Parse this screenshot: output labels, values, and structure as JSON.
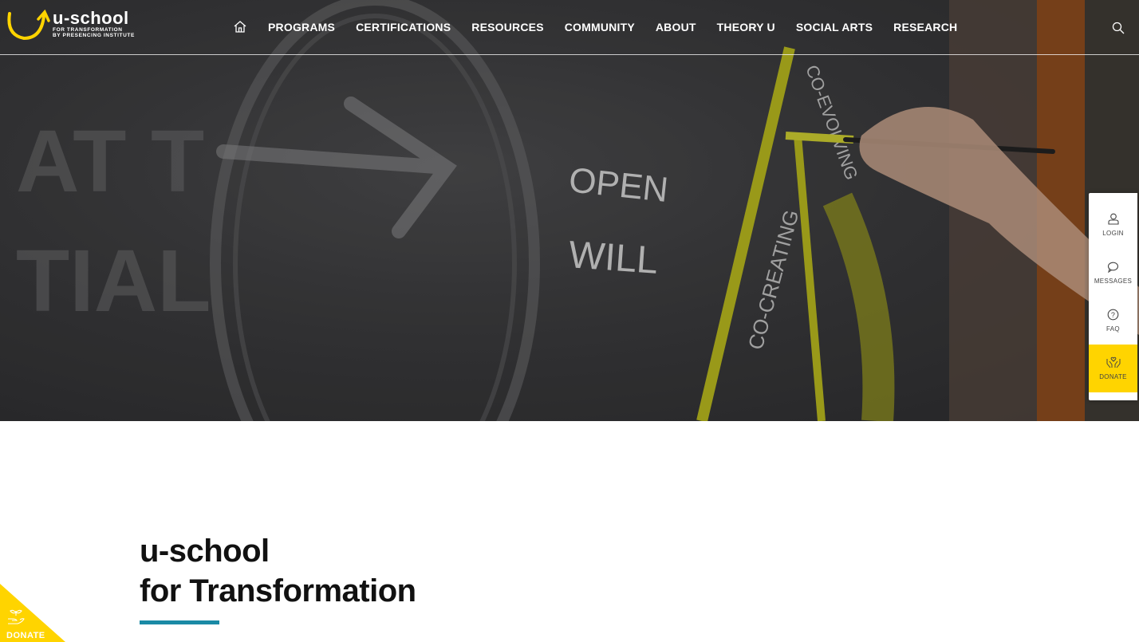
{
  "header": {
    "logo": {
      "main": "u-school",
      "sub1": "FOR TRANSFORMATION",
      "sub2": "BY PRESENCING INSTITUTE"
    },
    "nav": [
      "PROGRAMS",
      "CERTIFICATIONS",
      "RESOURCES",
      "COMMUNITY",
      "ABOUT",
      "THEORY U",
      "SOCIAL ARTS",
      "RESEARCH"
    ]
  },
  "hero": {
    "chalk_words": [
      "OPEN",
      "WILL",
      "CO-CREATING",
      "CO-EVOLVING"
    ]
  },
  "side_panel": {
    "login": "LOGIN",
    "messages": "MESSAGES",
    "faq": "FAQ",
    "donate": "DONATE"
  },
  "main": {
    "title_line1": "u-school",
    "title_line2": "for Transformation"
  },
  "corner_donate": {
    "label": "DONATE"
  },
  "colors": {
    "accent_yellow": "#ffd400",
    "accent_teal": "#1a8aa5"
  }
}
